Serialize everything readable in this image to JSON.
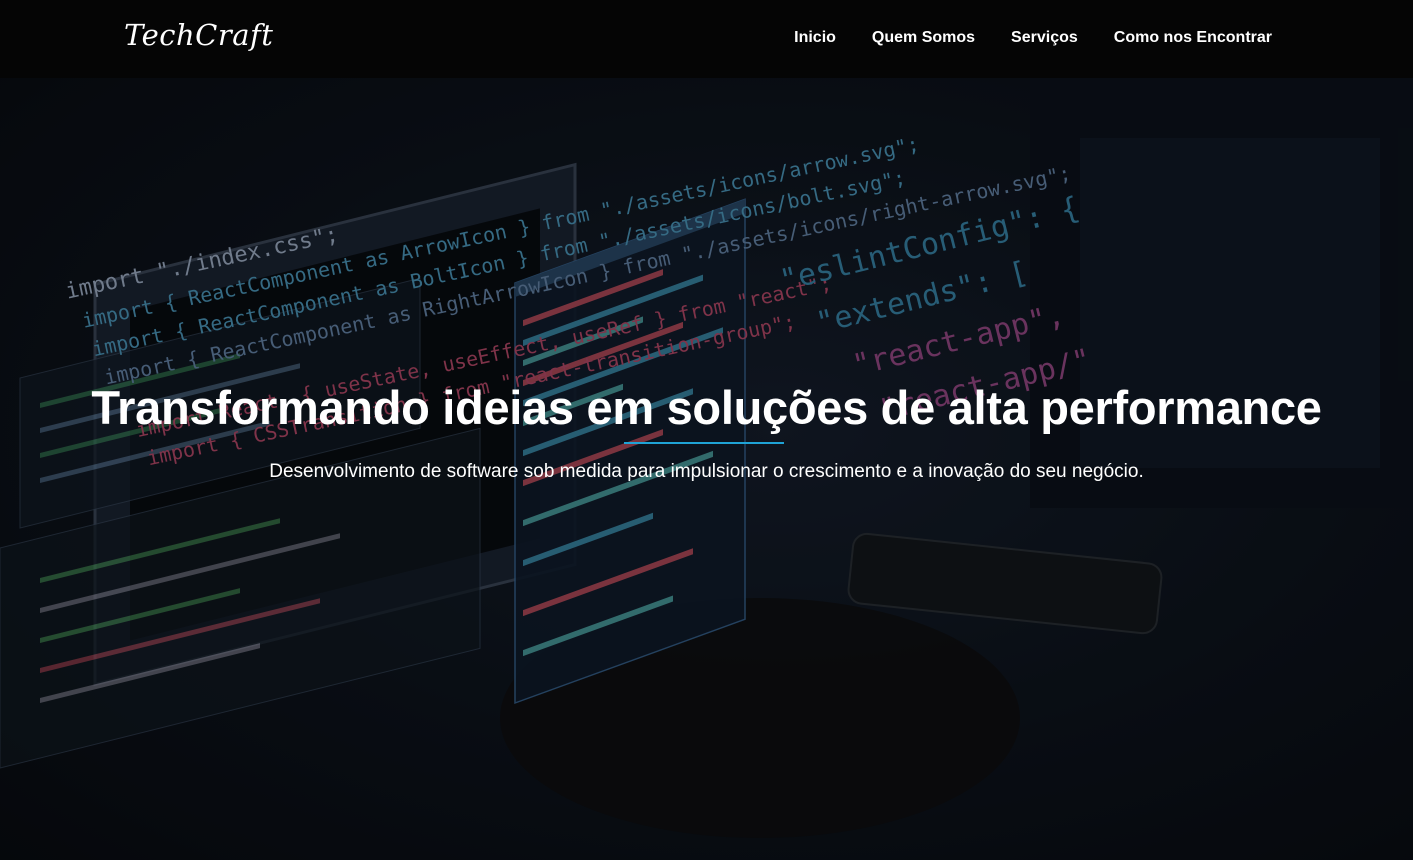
{
  "brand": {
    "name": "TechCraft"
  },
  "nav": {
    "items": [
      {
        "label": "Inicio"
      },
      {
        "label": "Quem Somos"
      },
      {
        "label": "Serviços"
      },
      {
        "label": "Como nos Encontrar"
      }
    ]
  },
  "hero": {
    "title": "Transformando ideias em soluções de alta performance",
    "subtitle": "Desenvolvimento de software sob medida para impulsionar o crescimento e a inovação do seu negócio.",
    "accent_color": "#1fa3d6",
    "background": {
      "code_lines": [
        "import \"./index.css\";",
        "import { ReactComponent as ArrowIcon } from \"./assets/icons/arrow.svg\";",
        "import { ReactComponent as BoltIcon } from \"./assets/icons/bolt.svg\";",
        "import { ReactComponent as RightArrowIcon } from \"./assets/icons/right-arrow.svg\";",
        "import React, { useState, useEffect, useRef } from \"react\";",
        "import { CSSTransition } from \"react-transition-group\";"
      ],
      "config_lines": [
        "\"eslintConfig\": {",
        "\"extends\": [",
        "\"react-app\",",
        "\"react-app/\""
      ]
    }
  }
}
